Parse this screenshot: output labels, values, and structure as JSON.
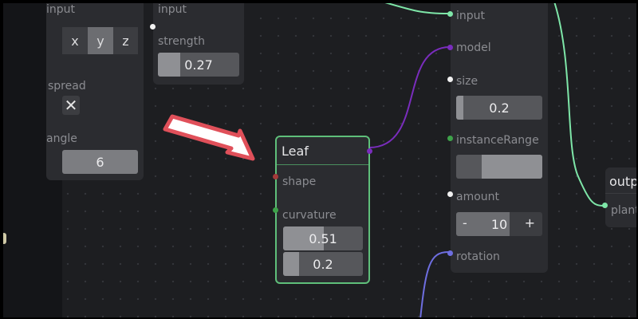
{
  "left_node": {
    "input_label": "input",
    "axis_options": [
      "x",
      "y",
      "z"
    ],
    "axis_selected": "y",
    "spread_label": "spread",
    "spread_checked": false,
    "angle_label": "angle",
    "angle_value": "6"
  },
  "strength_node": {
    "input_label": "input",
    "strength_label": "strength",
    "strength_value": "0.27"
  },
  "leaf_node": {
    "title": "Leaf",
    "shape_label": "shape",
    "curvature_label": "curvature",
    "curvature_values": [
      "0.51",
      "0.2"
    ]
  },
  "instance_node": {
    "input_label": "input",
    "model_label": "model",
    "size_label": "size",
    "size_value": "0.2",
    "instance_range_label": "instanceRange",
    "instance_range": [
      0.2,
      1.0
    ],
    "amount_label": "amount",
    "amount_minus": "-",
    "amount_value": "10",
    "amount_plus": "+",
    "rotation_label": "rotation"
  },
  "output_node": {
    "title": "outp",
    "plant_label": "plant"
  },
  "colors": {
    "canvas": "#1d1e21",
    "node": "#2b2c30",
    "selected_border": "#5fbf7a",
    "wire_green": "#7ee6a8",
    "wire_purple": "#7a2dbd",
    "wire_blue": "#6e6ee0",
    "arrow_fill": "#ffffff",
    "arrow_outline": "#e0505a"
  }
}
